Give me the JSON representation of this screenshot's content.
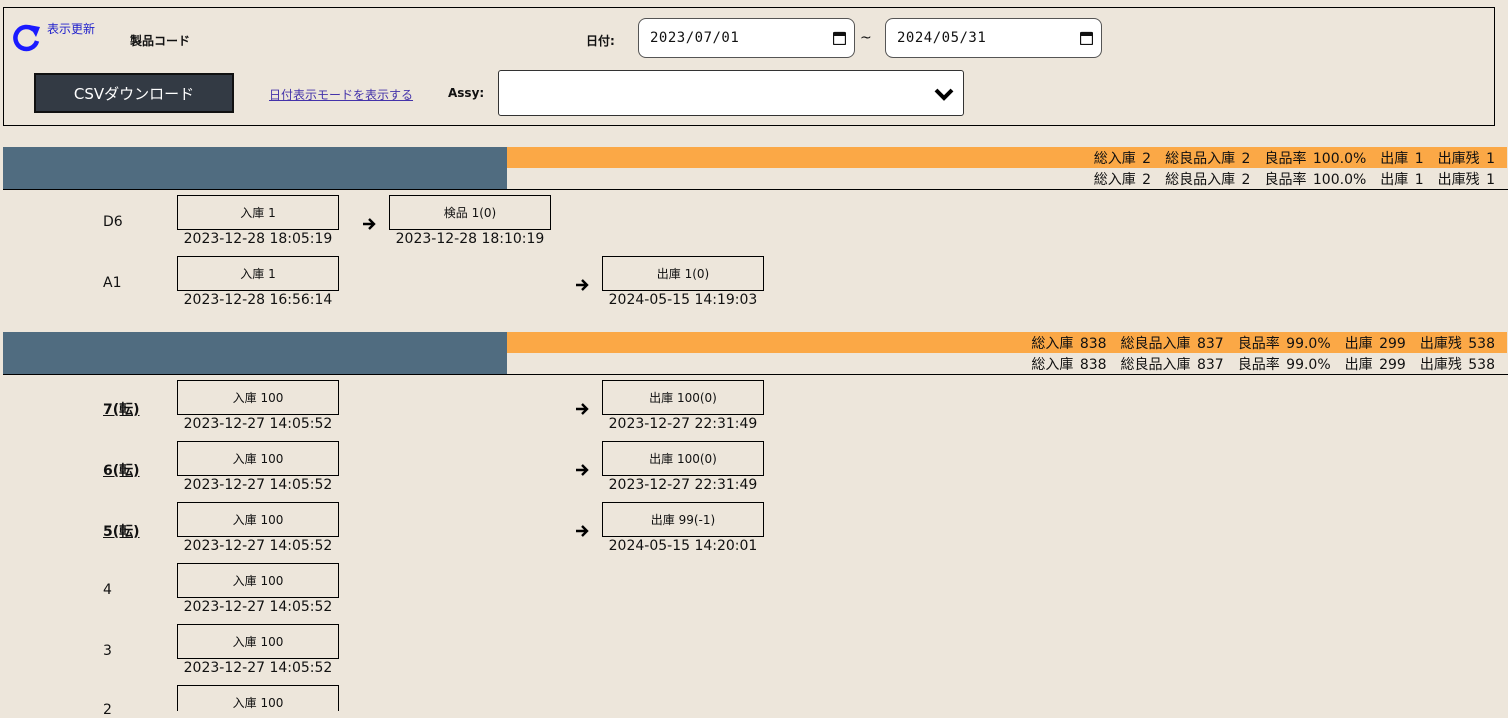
{
  "header": {
    "refresh_label": "表示更新",
    "product_code_label": "製品コード",
    "date_label": "日付:",
    "date_from": "2023/07/01",
    "date_to": "2024/05/31",
    "date_separator": "~",
    "csv_button_label": "CSVダウンロード",
    "date_mode_link": "日付表示モードを表示する",
    "assy_label": "Assy:",
    "assy_value": ""
  },
  "groups": [
    {
      "summary_top": "総入庫 2　総良品入庫 2　良品率 100.0%　出庫 1　出庫残 1",
      "summary_bottom": "総入庫 2　総良品入庫 2　良品率 100.0%　出庫 1　出庫残 1",
      "rows": [
        {
          "label": "D6",
          "in_label": "入庫 1",
          "in_time": "2023-12-28 18:05:19",
          "inspect_label": "検品 1(0)",
          "inspect_time": "2023-12-28 18:10:19"
        },
        {
          "label": "A1",
          "in_label": "入庫 1",
          "in_time": "2023-12-28 16:56:14",
          "out_label": "出庫 1(0)",
          "out_time": "2024-05-15 14:19:03"
        }
      ]
    },
    {
      "summary_top": "総入庫 838　総良品入庫 837　良品率 99.0%　出庫 299　出庫残 538",
      "summary_bottom": "総入庫 838　総良品入庫 837　良品率 99.0%　出庫 299　出庫残 538",
      "rows": [
        {
          "label": "7(転)",
          "in_label": "入庫 100",
          "in_time": "2023-12-27 14:05:52",
          "out_label": "出庫 100(0)",
          "out_time": "2023-12-27 22:31:49"
        },
        {
          "label": "6(転)",
          "in_label": "入庫 100",
          "in_time": "2023-12-27 14:05:52",
          "out_label": "出庫 100(0)",
          "out_time": "2023-12-27 22:31:49"
        },
        {
          "label": "5(転)",
          "in_label": "入庫 100",
          "in_time": "2023-12-27 14:05:52",
          "out_label": "出庫 99(-1)",
          "out_time": "2024-05-15 14:20:01"
        },
        {
          "label": "4",
          "in_label": "入庫 100",
          "in_time": "2023-12-27 14:05:52"
        },
        {
          "label": "3",
          "in_label": "入庫 100",
          "in_time": "2023-12-27 14:05:52"
        },
        {
          "label": "2",
          "in_label": "入庫 100"
        }
      ]
    }
  ],
  "colors": {
    "background": "#ede6db",
    "group_bar_dark": "#506c80",
    "group_bar_orange": "#fba846",
    "link": "#4433aa",
    "refresh": "#2222cc"
  }
}
